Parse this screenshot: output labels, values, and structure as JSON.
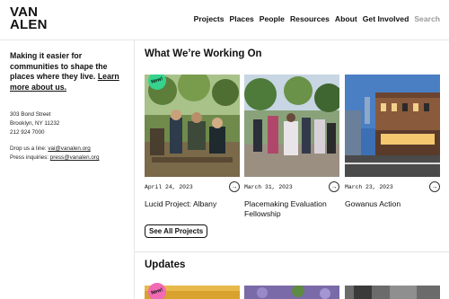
{
  "header": {
    "logo_line1": "VAN",
    "logo_line2": "ALEN",
    "nav": [
      "Projects",
      "Places",
      "People",
      "Resources",
      "About",
      "Get Involved"
    ],
    "search_label": "Search"
  },
  "sidebar": {
    "tagline": "Making it easier for communities to shape the places where they live.",
    "learn_more": "Learn more about us.",
    "address_lines": [
      "303 Bond Street",
      "Brooklyn, NY 11232",
      "212 924 7000"
    ],
    "drop_line_prefix": "Drop us a line:",
    "drop_line_email": "vai@vanalen.org",
    "press_prefix": "Press inquiries:",
    "press_email": "press@vanalen.org"
  },
  "main": {
    "working_title": "What We’re Working On",
    "cards": [
      {
        "date": "April 24, 2023",
        "title": "Lucid Project: Albany",
        "badge": "New!",
        "image": "people-seated-outdoors-photo"
      },
      {
        "date": "March 31, 2023",
        "title": "Placemaking Evaluation Fellowship",
        "badge": "",
        "image": "street-event-crowd-photo"
      },
      {
        "date": "March 23, 2023",
        "title": "Gowanus Action",
        "badge": "",
        "image": "evening-street-buildings-photo"
      }
    ],
    "see_all_label": "See All Projects",
    "updates_title": "Updates",
    "update_badge": "New!"
  },
  "colors": {
    "badge_green": "#35d38d",
    "badge_pink": "#f06ab4",
    "divider": "#e6e6e6",
    "muted": "#9a9a9a"
  },
  "icons": {
    "card_arrow": "arrow-right-circle-icon"
  }
}
